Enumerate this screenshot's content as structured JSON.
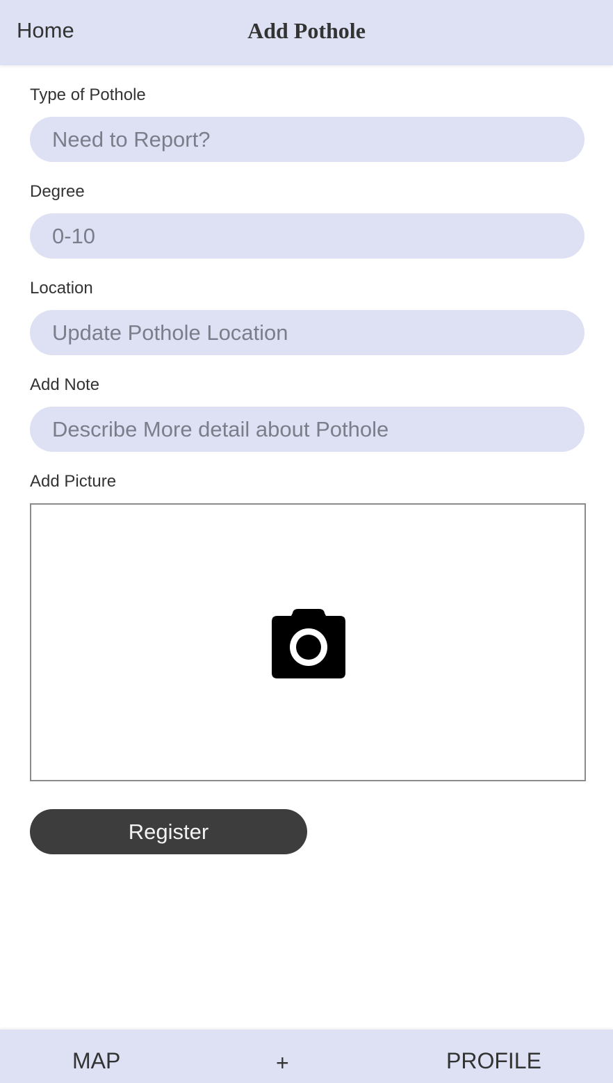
{
  "header": {
    "home_label": "Home",
    "title": "Add Pothole"
  },
  "form": {
    "type": {
      "label": "Type of Pothole",
      "value": "",
      "placeholder": "Need to Report?"
    },
    "degree": {
      "label": "Degree",
      "value": "",
      "placeholder": "0-10"
    },
    "location": {
      "label": "Location",
      "value": "",
      "placeholder": "Update Pothole Location"
    },
    "note": {
      "label": "Add Note",
      "value": "",
      "placeholder": "Describe More detail about Pothole"
    },
    "picture": {
      "label": "Add Picture",
      "icon": "camera-icon"
    },
    "submit_label": "Register"
  },
  "bottom_nav": {
    "map_label": "MAP",
    "add_label": "+",
    "profile_label": "PROFILE"
  },
  "colors": {
    "accent_bg": "#dde1f3",
    "button_bg": "#3d3d3d",
    "text": "#333333",
    "placeholder": "#7b7e8a"
  }
}
